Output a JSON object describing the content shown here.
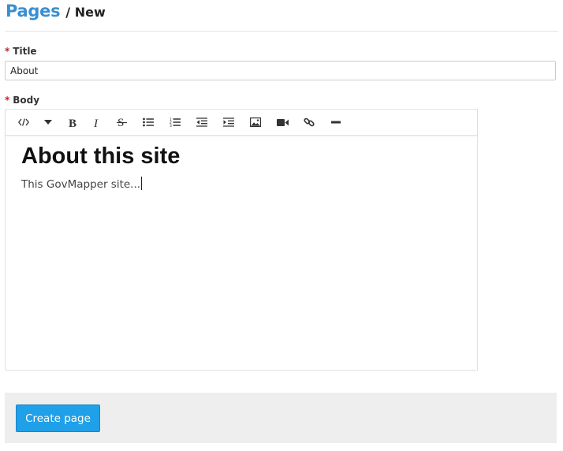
{
  "header": {
    "section_link": "Pages",
    "current": "/ New"
  },
  "form": {
    "title_label": "Title",
    "title_value": "About",
    "body_label": "Body",
    "required_marker": "*",
    "editor": {
      "toolbar_icons": [
        "code-view-icon",
        "caret-down-icon",
        "bold-icon",
        "italic-icon",
        "strikethrough-icon",
        "bulleted-list-icon",
        "numbered-list-icon",
        "outdent-icon",
        "indent-icon",
        "image-icon",
        "video-icon",
        "link-icon",
        "horizontal-rule-icon"
      ],
      "heading": "About this site",
      "paragraph": "This GovMapper site..."
    },
    "submit_label": "Create page"
  },
  "colors": {
    "link": "#3a8fd0",
    "primary_button": "#1fa0e8",
    "required": "#cc2222",
    "footer_bg": "#eeeeee"
  }
}
